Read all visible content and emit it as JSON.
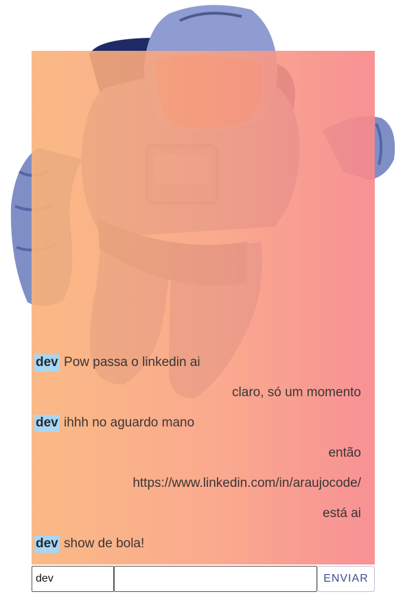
{
  "colors": {
    "panel_left": "#FAB278",
    "panel_right": "#F7888C",
    "user_tag_bg": "#A9D6F2",
    "suit_blue": "#7F8FC6",
    "send_text": "#3D4A8F"
  },
  "background": {
    "illustration": "astronaut-illustration"
  },
  "chat": {
    "messages": [
      {
        "from": "dev",
        "text": "Pow passa o linkedin ai",
        "align": "left"
      },
      {
        "text": "claro, só um momento",
        "align": "right"
      },
      {
        "from": "dev",
        "text": "ihhh no aguardo mano",
        "align": "left"
      },
      {
        "text": "então",
        "align": "right"
      },
      {
        "text": "https://www.linkedin.com/in/araujocode/",
        "align": "right"
      },
      {
        "text": "está ai",
        "align": "right"
      },
      {
        "from": "dev",
        "text": "show de bola!",
        "align": "left"
      }
    ]
  },
  "form": {
    "username_value": "dev",
    "message_value": "",
    "send_label": "ENVIAR"
  }
}
